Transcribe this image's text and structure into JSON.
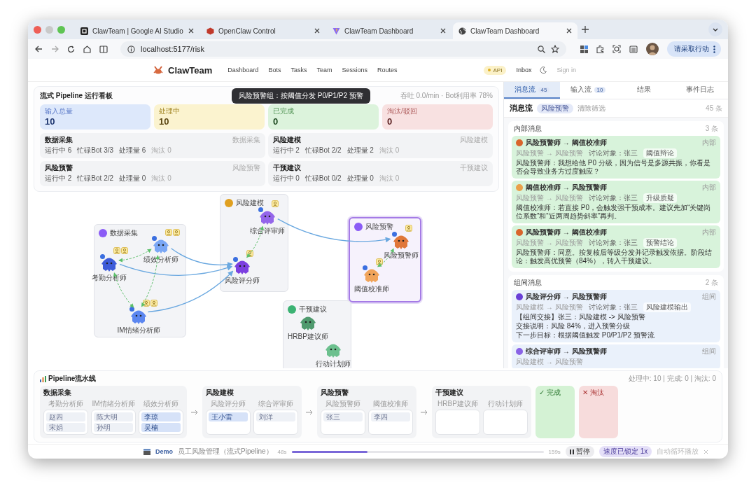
{
  "browser": {
    "tabs": [
      {
        "title": "ClawTeam | Google AI Studio",
        "selected": false,
        "kind": "studio"
      },
      {
        "title": "OpenClaw Control",
        "selected": false,
        "kind": "claw"
      },
      {
        "title": "ClawTeam Dashboard",
        "selected": false,
        "kind": "vite"
      },
      {
        "title": "ClawTeam Dashboard",
        "selected": true,
        "kind": "globe"
      }
    ],
    "url": "localhost:5177/risk",
    "action_button": "请采取行动"
  },
  "nav": {
    "brand": "ClawTeam",
    "links": [
      "Dashboard",
      "Bots",
      "Tasks",
      "Team",
      "Sessions",
      "Routes"
    ],
    "api_badge": "API",
    "inbox": "Inbox",
    "sign_in": "Sign in"
  },
  "board": {
    "title": "流式 Pipeline 运行看板",
    "tooltip": "风险预警组：按阈值分发 P0/P1/P2 预警",
    "summary": "吞吐 0.0/min · Bot利用率 78%",
    "stats": [
      {
        "label": "输入总量",
        "value": "10",
        "kind": "input"
      },
      {
        "label": "处理中",
        "value": "10",
        "kind": "processing"
      },
      {
        "label": "已完成",
        "value": "0",
        "kind": "done"
      },
      {
        "label": "淘汰/驳回",
        "value": "0",
        "kind": "rejected"
      }
    ],
    "groups": [
      {
        "name": "数据采集",
        "tag": "数据采集",
        "metrics": [
          "运行中 6",
          "忙碌Bot 3/3",
          "处理量 6",
          "淘汰 0"
        ]
      },
      {
        "name": "风险建模",
        "tag": "风险建模",
        "metrics": [
          "运行中 2",
          "忙碌Bot 2/2",
          "处理量 2",
          "淘汰 0"
        ]
      },
      {
        "name": "风险预警",
        "tag": "风险预警",
        "metrics": [
          "运行中 2",
          "忙碌Bot 2/2",
          "处理量 0",
          "淘汰 0"
        ]
      },
      {
        "name": "干预建议",
        "tag": "干预建议",
        "metrics": [
          "运行中 0",
          "忙碌Bot 0/2",
          "处理量 0",
          "淘汰 0"
        ]
      }
    ]
  },
  "canvas": {
    "groups": [
      {
        "name": "数据采集",
        "color": "#8b5cf6",
        "selected": false
      },
      {
        "name": "风险建模",
        "color": "#e0a020",
        "selected": false
      },
      {
        "name": "风险预警",
        "color": "#8b5cf6",
        "selected": true
      },
      {
        "name": "干预建议",
        "color": "#3bb273",
        "selected": false
      }
    ],
    "bots": [
      {
        "name": "考勤分析师",
        "color": "#3d5bd9",
        "busy": true
      },
      {
        "name": "绩效分析师",
        "color": "#7aa7f5",
        "busy": true
      },
      {
        "name": "IM情绪分析师",
        "color": "#5b86f0",
        "busy": true
      },
      {
        "name": "风险评分师",
        "color": "#7c3fe0",
        "busy": true
      },
      {
        "name": "综合评审师",
        "color": "#9466ea",
        "busy": true
      },
      {
        "name": "风险预警师",
        "color": "#e0773a",
        "busy": true
      },
      {
        "name": "阈值校准师",
        "color": "#f0a45a",
        "busy": true
      },
      {
        "name": "HRBP建议师",
        "color": "#4f9a6e",
        "busy": false
      },
      {
        "name": "行动计划师",
        "color": "#6cc08e",
        "busy": false
      }
    ]
  },
  "messages": {
    "tabs": [
      {
        "label": "消息流",
        "count": "45",
        "selected": true
      },
      {
        "label": "输入流",
        "count": "10",
        "selected": false
      },
      {
        "label": "结果",
        "selected": false
      },
      {
        "label": "事件日志",
        "selected": false
      }
    ],
    "title": "消息流",
    "filter": "风险预警",
    "clear": "清除筛选",
    "total": "45 条",
    "sections": [
      {
        "title": "内部消息",
        "count": "3 条",
        "kind": "internal",
        "items": [
          {
            "title": "风险预警师 → 阈值校准师",
            "color": "#d9652b",
            "tag": "内部",
            "route": "风险预警 → 风险预警",
            "subject": "讨论对象：张三",
            "topic": "阈值辩论",
            "lines": [
              "风险预警师：我想给他 P0 分级，因为信号是多源共振，你看是否会导致业务方过度触应？"
            ]
          },
          {
            "title": "阈值校准师 → 风险预警师",
            "color": "#eaa04a",
            "tag": "内部",
            "route": "风险预警 → 风险预警",
            "subject": "讨论对象：张三",
            "topic": "升级质疑",
            "lines": [
              "阈值校准师：若直接 P0，会触发强干预成本。建议先加“关键岗位系数”和“近两周趋势斜率”再判。"
            ]
          },
          {
            "title": "风险预警师 → 阈值校准师",
            "color": "#d9652b",
            "tag": "内部",
            "route": "风险预警 → 风险预警",
            "subject": "讨论对象：张三",
            "topic": "预警结论",
            "lines": [
              "风险预警师：同意。按复核后等级分发并记录触发依据。阶段结论：触发高优预警（84%），转入干预建议。"
            ]
          }
        ]
      },
      {
        "title": "组间消息",
        "count": "2 条",
        "kind": "between",
        "items": [
          {
            "title": "风险评分师 → 风险预警师",
            "color": "#6a3fd6",
            "tag": "组间",
            "route": "风险建模 → 风险预警",
            "subject": "讨论对象：张三",
            "topic": "风险建模输出",
            "lines": [
              "【组间交接】张三：风险建模 -> 风险预警",
              "交接说明：风险 84%，进入预警分级",
              "下一步目标：根据阈值触发 P0/P1/P2 预警流"
            ]
          },
          {
            "title": "综合评审师 → 风险预警师",
            "color": "#8a63e6",
            "tag": "组间",
            "route": "风险建模 → 风险预警"
          }
        ]
      }
    ]
  },
  "pipeline": {
    "title": "Pipeline流水线",
    "summary": "处理中: 10 | 完成: 0 | 淘汰: 0",
    "stages": [
      {
        "name": "数据采集",
        "kind": "stage",
        "columns": [
          {
            "name": "考勤分析师",
            "items": [
              {
                "name": "赵四",
                "highlighted": false
              },
              {
                "name": "宋娟",
                "highlighted": false
              }
            ]
          },
          {
            "name": "IM情绪分析师",
            "items": [
              {
                "name": "陈大明",
                "highlighted": false
              },
              {
                "name": "孙明",
                "highlighted": false
              }
            ]
          },
          {
            "name": "绩效分析师",
            "items": [
              {
                "name": "李琼",
                "highlighted": true
              },
              {
                "name": "吴楠",
                "highlighted": true
              }
            ]
          }
        ]
      },
      {
        "name": "风险建模",
        "kind": "stage",
        "columns": [
          {
            "name": "风险评分师",
            "items": [
              {
                "name": "王小雷",
                "highlighted": true
              }
            ]
          },
          {
            "name": "综合评审师",
            "items": [
              {
                "name": "刘洋",
                "highlighted": false
              }
            ]
          }
        ]
      },
      {
        "name": "风险预警",
        "kind": "stage",
        "columns": [
          {
            "name": "风险预警师",
            "items": [
              {
                "name": "张三",
                "highlighted": false
              }
            ]
          },
          {
            "name": "阈值校准师",
            "items": [
              {
                "name": "李四",
                "highlighted": false
              }
            ]
          }
        ]
      },
      {
        "name": "干预建议",
        "kind": "stage",
        "columns": [
          {
            "name": "HRBP建议师"
          },
          {
            "name": "行动计划师"
          }
        ]
      },
      {
        "name": "✓ 完成",
        "kind": "done"
      },
      {
        "name": "✕ 淘汰",
        "kind": "rejected"
      }
    ]
  },
  "player": {
    "label": "Demo",
    "scenario": "员工风险管理（流式Pipeline）",
    "elapsed": "48s",
    "level": 0.3,
    "total": "159s",
    "pause": "暂停",
    "speed": "速度已锁定 1x",
    "loop": "自动循环播放"
  }
}
